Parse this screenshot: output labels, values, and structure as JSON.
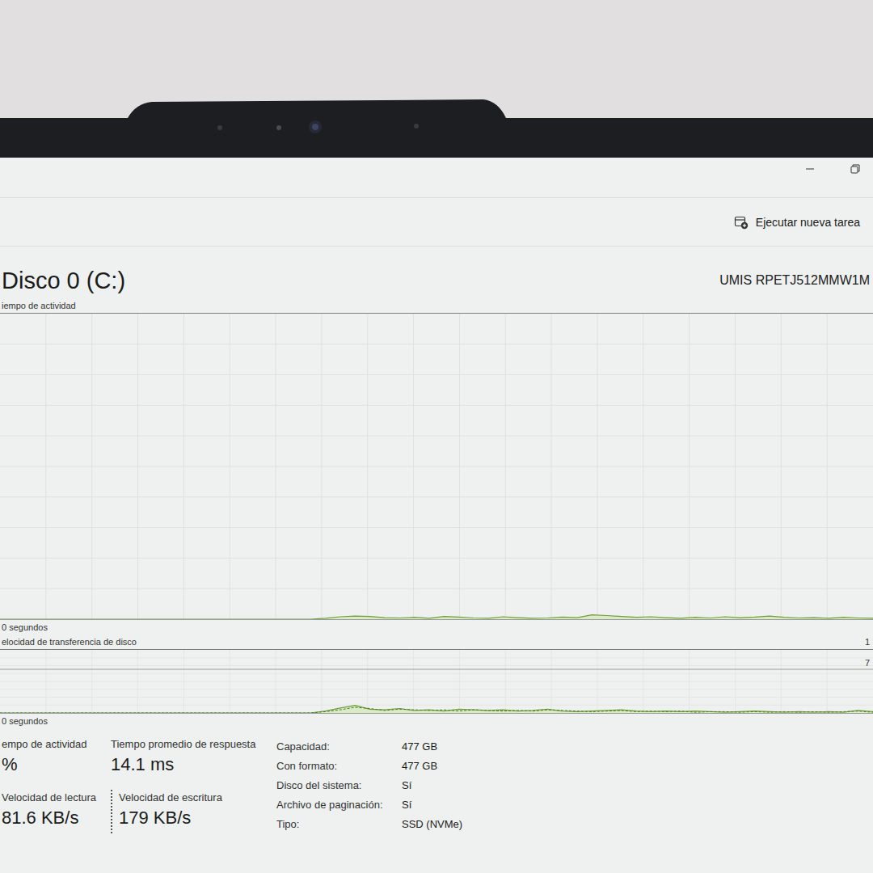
{
  "toolbar": {
    "run_task": "Ejecutar nueva tarea"
  },
  "disk": {
    "title": "Disco 0 (C:)",
    "model": "UMIS RPETJ512MMW1M"
  },
  "activity_chart": {
    "label": "iempo de actividad",
    "time_label": "0 segundos",
    "values": [
      0,
      0,
      0,
      0,
      0,
      0,
      0,
      0,
      0,
      0,
      0,
      0,
      0,
      0,
      0,
      0,
      0,
      0,
      0,
      0,
      0,
      0,
      0.3,
      0.8,
      1,
      0.9,
      0.5,
      0.4,
      0.6,
      0.3,
      0.9,
      0.7,
      0.4,
      0.3,
      0.8,
      0.5,
      0.3,
      0.4,
      0.7,
      0.5,
      1.4,
      1.2,
      0.9,
      0.6,
      0.8,
      0.5,
      0.3,
      0.6,
      0.4,
      0.8,
      0.5,
      0.7,
      1,
      0.6,
      0.4,
      0.5,
      0.3,
      0.6,
      0.4,
      0.3
    ]
  },
  "transfer_chart": {
    "label": "elocidad de transferencia de disco",
    "time_label": "0 segundos",
    "ticks": [
      "1",
      "7"
    ],
    "read_values": [
      0,
      0,
      0,
      0,
      0,
      0,
      0,
      0,
      0,
      0,
      0,
      0,
      0,
      0,
      0,
      0,
      0,
      0,
      0,
      0,
      0,
      0,
      0.03,
      0.08,
      0.12,
      0.06,
      0.05,
      0.07,
      0.04,
      0.05,
      0.03,
      0.06,
      0.05,
      0.04,
      0.05,
      0.03,
      0.04,
      0.06,
      0.03,
      0.02,
      0.03,
      0.04,
      0.05,
      0.03,
      0.02,
      0.03,
      0.02,
      0.03,
      0.02,
      0.01,
      0.02,
      0.03,
      0.02,
      0.01,
      0.02,
      0.01,
      0.02,
      0.01,
      0.04,
      0.02
    ],
    "write_values": [
      0,
      0,
      0,
      0,
      0,
      0,
      0,
      0,
      0,
      0,
      0,
      0,
      0,
      0,
      0,
      0,
      0,
      0,
      0,
      0,
      0,
      0,
      0.02,
      0.05,
      0.09,
      0.07,
      0.04,
      0.06,
      0.05,
      0.04,
      0.05,
      0.03,
      0.05,
      0.04,
      0.03,
      0.04,
      0.03,
      0.05,
      0.04,
      0.03,
      0.02,
      0.03,
      0.04,
      0.02,
      0.03,
      0.02,
      0.03,
      0.01,
      0.02,
      0.02,
      0.01,
      0.02,
      0.01,
      0.02,
      0.01,
      0.02,
      0.01,
      0.02,
      0.03,
      0.01
    ]
  },
  "stats": [
    {
      "label": "empo de actividad",
      "value": "%",
      "kind": "plain"
    },
    {
      "label": "Tiempo promedio de respuesta",
      "value": "14.1 ms",
      "kind": "plain"
    },
    {
      "label": "Velocidad de lectura",
      "value": "81.6 KB/s",
      "kind": "plain"
    },
    {
      "label": "Velocidad de escritura",
      "value": "179 KB/s",
      "kind": "dashed"
    }
  ],
  "details": [
    {
      "label": "Capacidad:",
      "value": "477 GB"
    },
    {
      "label": "Con formato:",
      "value": "477 GB"
    },
    {
      "label": "Disco del sistema:",
      "value": "Sí"
    },
    {
      "label": "Archivo de paginación:",
      "value": "Sí"
    },
    {
      "label": "Tipo:",
      "value": "SSD (NVMe)"
    }
  ]
}
